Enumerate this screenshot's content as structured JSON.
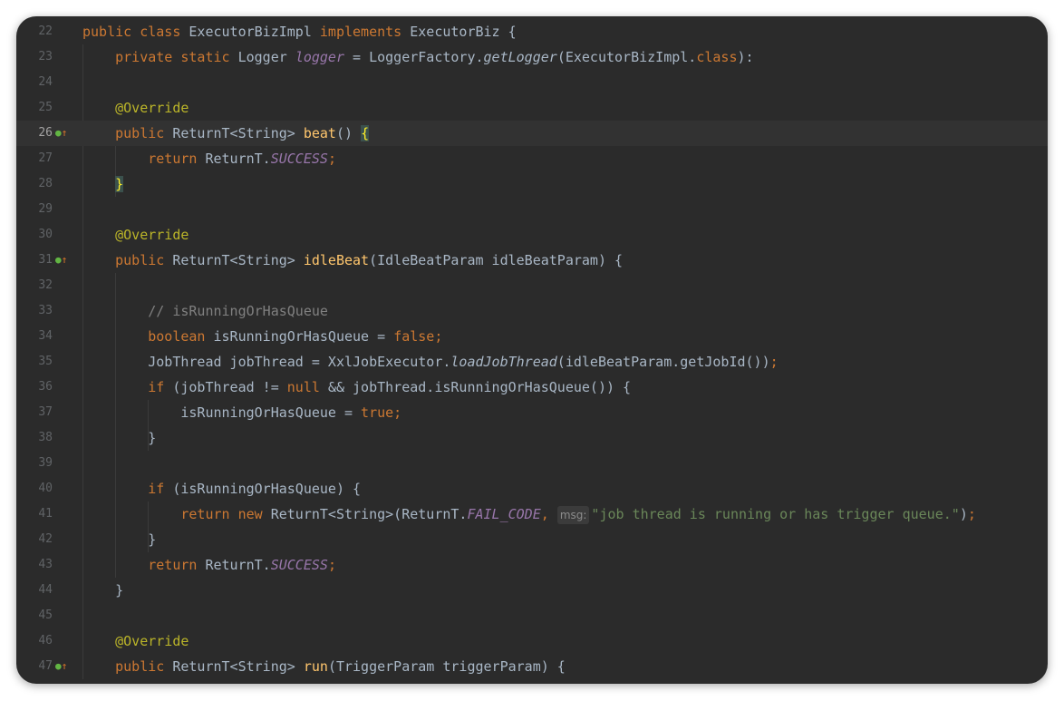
{
  "editor": {
    "lines": [
      {
        "num": "22",
        "tokens": [
          [
            "kw",
            "public class "
          ],
          [
            "",
            "ExecutorBizImpl "
          ],
          [
            "kw",
            "implements "
          ],
          [
            "",
            "ExecutorBiz {"
          ]
        ]
      },
      {
        "num": "23",
        "tokens": [
          [
            "",
            "    "
          ],
          [
            "kw",
            "private static "
          ],
          [
            "",
            "Logger "
          ],
          [
            "fld",
            "logger"
          ],
          [
            "",
            " = LoggerFactory."
          ],
          [
            "it",
            "getLogger"
          ],
          [
            "",
            "(ExecutorBizImpl."
          ],
          [
            "kw",
            "class"
          ],
          [
            "",
            "):"
          ]
        ]
      },
      {
        "num": "24",
        "tokens": []
      },
      {
        "num": "25",
        "tokens": [
          [
            "",
            "    "
          ],
          [
            "ann",
            "@Override"
          ]
        ]
      },
      {
        "num": "26",
        "marker": true,
        "current": true,
        "tokens": [
          [
            "",
            "    "
          ],
          [
            "kw",
            "public "
          ],
          [
            "",
            "ReturnT<String> "
          ],
          [
            "mth",
            "beat"
          ],
          [
            "",
            "() "
          ],
          [
            "brace-hl",
            "{"
          ]
        ]
      },
      {
        "num": "27",
        "tokens": [
          [
            "",
            "        "
          ],
          [
            "kw",
            "return "
          ],
          [
            "",
            "ReturnT."
          ],
          [
            "fld",
            "SUCCESS"
          ],
          [
            "kw",
            ";"
          ]
        ]
      },
      {
        "num": "28",
        "tokens": [
          [
            "",
            "    "
          ],
          [
            "brace-hl",
            "}"
          ]
        ]
      },
      {
        "num": "29",
        "tokens": []
      },
      {
        "num": "30",
        "tokens": [
          [
            "",
            "    "
          ],
          [
            "ann",
            "@Override"
          ]
        ]
      },
      {
        "num": "31",
        "marker": true,
        "tokens": [
          [
            "",
            "    "
          ],
          [
            "kw",
            "public "
          ],
          [
            "",
            "ReturnT<String> "
          ],
          [
            "mth",
            "idleBeat"
          ],
          [
            "",
            "(IdleBeatParam idleBeatParam) {"
          ]
        ]
      },
      {
        "num": "32",
        "tokens": []
      },
      {
        "num": "33",
        "tokens": [
          [
            "",
            "        "
          ],
          [
            "cmt",
            "// isRunningOrHasQueue"
          ]
        ]
      },
      {
        "num": "34",
        "tokens": [
          [
            "",
            "        "
          ],
          [
            "kw",
            "boolean "
          ],
          [
            "",
            "isRunningOrHasQueue = "
          ],
          [
            "kw",
            "false;"
          ]
        ]
      },
      {
        "num": "35",
        "tokens": [
          [
            "",
            "        JobThread jobThread = XxlJobExecutor."
          ],
          [
            "it",
            "loadJobThread"
          ],
          [
            "",
            "(idleBeatParam.getJobId())"
          ],
          [
            "kw",
            ";"
          ]
        ]
      },
      {
        "num": "36",
        "tokens": [
          [
            "",
            "        "
          ],
          [
            "kw",
            "if "
          ],
          [
            "",
            "(jobThread != "
          ],
          [
            "kw",
            "null "
          ],
          [
            "",
            "&& jobThread.isRunningOrHasQueue()) {"
          ]
        ]
      },
      {
        "num": "37",
        "tokens": [
          [
            "",
            "            isRunningOrHasQueue = "
          ],
          [
            "kw",
            "true;"
          ]
        ]
      },
      {
        "num": "38",
        "tokens": [
          [
            "",
            "        }"
          ]
        ]
      },
      {
        "num": "39",
        "tokens": []
      },
      {
        "num": "40",
        "tokens": [
          [
            "",
            "        "
          ],
          [
            "kw",
            "if "
          ],
          [
            "",
            "(isRunningOrHasQueue) {"
          ]
        ]
      },
      {
        "num": "41",
        "tokens": [
          [
            "",
            "            "
          ],
          [
            "kw",
            "return new "
          ],
          [
            "",
            "ReturnT<String>(ReturnT."
          ],
          [
            "fld",
            "FAIL_CODE"
          ],
          [
            "kw",
            ", "
          ],
          [
            "hint",
            "msg:"
          ],
          [
            "str",
            "\"job thread is running or has trigger queue.\""
          ],
          [
            "",
            ")"
          ],
          [
            "kw",
            ";"
          ]
        ]
      },
      {
        "num": "42",
        "tokens": [
          [
            "",
            "        }"
          ]
        ]
      },
      {
        "num": "43",
        "tokens": [
          [
            "",
            "        "
          ],
          [
            "kw",
            "return "
          ],
          [
            "",
            "ReturnT."
          ],
          [
            "fld",
            "SUCCESS"
          ],
          [
            "kw",
            ";"
          ]
        ]
      },
      {
        "num": "44",
        "tokens": [
          [
            "",
            "    }"
          ]
        ]
      },
      {
        "num": "45",
        "tokens": []
      },
      {
        "num": "46",
        "tokens": [
          [
            "",
            "    "
          ],
          [
            "ann",
            "@Override"
          ]
        ]
      },
      {
        "num": "47",
        "marker": true,
        "tokens": [
          [
            "",
            "    "
          ],
          [
            "kw",
            "public "
          ],
          [
            "",
            "ReturnT<String> "
          ],
          [
            "mth",
            "run"
          ],
          [
            "",
            "(TriggerParam triggerParam) {"
          ]
        ]
      }
    ],
    "marker_glyphs": {
      "impl": "●",
      "up": "↑"
    },
    "colors": {
      "background": "#2b2b2b",
      "keyword": "#cc7832",
      "annotation": "#bbb529",
      "field": "#9876aa",
      "method": "#ffc66d",
      "string": "#6a8759",
      "comment": "#808080",
      "text": "#a9b7c6"
    }
  }
}
